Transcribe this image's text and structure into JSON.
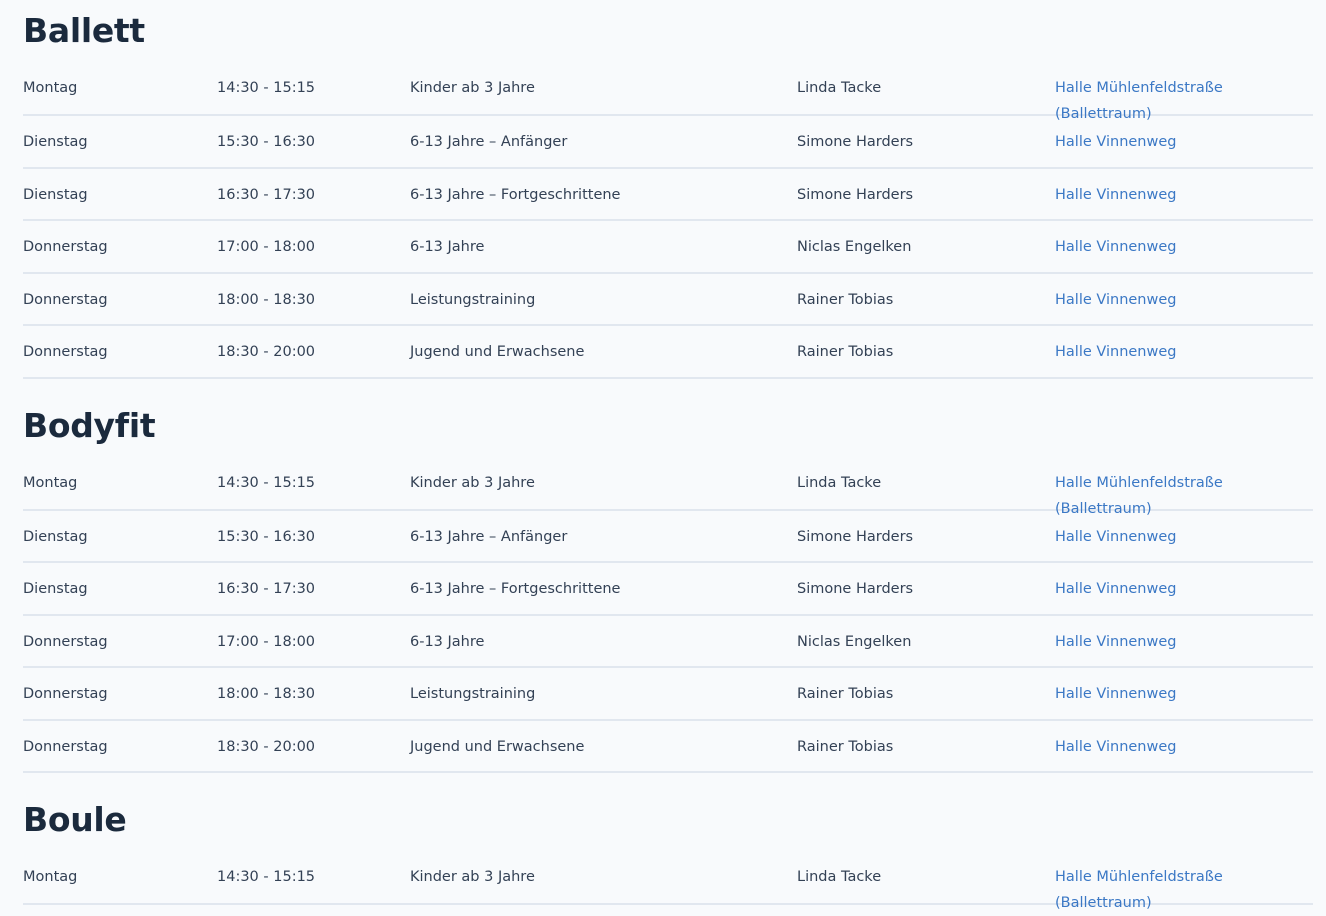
{
  "sections": [
    {
      "title": "Ballett",
      "rows": [
        {
          "day": "Montag",
          "time": "14:30 - 15:15",
          "group": "Kinder ab 3 Jahre",
          "trainer": "Linda Tacke",
          "location": "Halle Mühlenfeldstraße",
          "location_sub": "(Ballettraum)"
        },
        {
          "day": "Dienstag",
          "time": "15:30 - 16:30",
          "group": "6-13 Jahre – Anfänger",
          "trainer": "Simone Harders",
          "location": "Halle Vinnenweg"
        },
        {
          "day": "Dienstag",
          "time": "16:30 - 17:30",
          "group": "6-13 Jahre – Fortgeschrittene",
          "trainer": "Simone Harders",
          "location": "Halle Vinnenweg"
        },
        {
          "day": "Donnerstag",
          "time": "17:00 - 18:00",
          "group": "6-13 Jahre",
          "trainer": "Niclas Engelken",
          "location": "Halle Vinnenweg"
        },
        {
          "day": "Donnerstag",
          "time": "18:00 - 18:30",
          "group": "Leistungstraining",
          "trainer": "Rainer Tobias",
          "location": "Halle Vinnenweg"
        },
        {
          "day": "Donnerstag",
          "time": "18:30 - 20:00",
          "group": "Jugend und Erwachsene",
          "trainer": "Rainer Tobias",
          "location": "Halle Vinnenweg"
        }
      ]
    },
    {
      "title": "Bodyfit",
      "rows": [
        {
          "day": "Montag",
          "time": "14:30 - 15:15",
          "group": "Kinder ab 3 Jahre",
          "trainer": "Linda Tacke",
          "location": "Halle Mühlenfeldstraße",
          "location_sub": "(Ballettraum)"
        },
        {
          "day": "Dienstag",
          "time": "15:30 - 16:30",
          "group": "6-13 Jahre – Anfänger",
          "trainer": "Simone Harders",
          "location": "Halle Vinnenweg"
        },
        {
          "day": "Dienstag",
          "time": "16:30 - 17:30",
          "group": "6-13 Jahre – Fortgeschrittene",
          "trainer": "Simone Harders",
          "location": "Halle Vinnenweg"
        },
        {
          "day": "Donnerstag",
          "time": "17:00 - 18:00",
          "group": "6-13 Jahre",
          "trainer": "Niclas Engelken",
          "location": "Halle Vinnenweg"
        },
        {
          "day": "Donnerstag",
          "time": "18:00 - 18:30",
          "group": "Leistungstraining",
          "trainer": "Rainer Tobias",
          "location": "Halle Vinnenweg"
        },
        {
          "day": "Donnerstag",
          "time": "18:30 - 20:00",
          "group": "Jugend und Erwachsene",
          "trainer": "Rainer Tobias",
          "location": "Halle Vinnenweg"
        }
      ]
    },
    {
      "title": "Boule",
      "rows": [
        {
          "day": "Montag",
          "time": "14:30 - 15:15",
          "group": "Kinder ab 3 Jahre",
          "trainer": "Linda Tacke",
          "location": "Halle Mühlenfeldstraße",
          "location_sub": "(Ballettraum)"
        }
      ]
    }
  ],
  "colors": {
    "heading": "#1b2a3d",
    "text": "#334155",
    "link": "#3b78c5",
    "divider": "#e1e7ef",
    "background": "#f8fafc"
  }
}
